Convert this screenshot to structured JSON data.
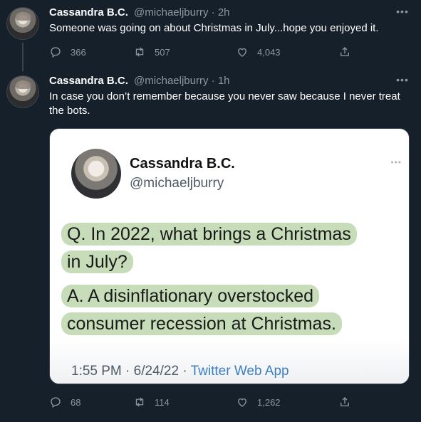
{
  "tweets": [
    {
      "name": "Cassandra B.C.",
      "handle": "@michaeljburry",
      "dot": "·",
      "time": "2h",
      "text": "Someone was going on about Christmas in July...hope you enjoyed it.",
      "counts": {
        "replies": "366",
        "retweets": "507",
        "likes": "4,043"
      }
    },
    {
      "name": "Cassandra B.C.",
      "handle": "@michaeljburry",
      "dot": "·",
      "time": "1h",
      "text": "In case you don’t remember because you never saw because I never treat the bots.",
      "counts": {
        "replies": "68",
        "retweets": "114",
        "likes": "1,262"
      },
      "media": {
        "name": "Cassandra B.C.",
        "handle": "@michaeljburry",
        "lines": [
          "Q. In 2022, what brings a Christmas",
          "in July?",
          "A. A disinflationary overstocked",
          "consumer recession at Christmas."
        ],
        "timestamp": "1:55 PM · 6/24/22 ·",
        "source": "Twitter Web App"
      }
    }
  ],
  "icons": {
    "more": "more-icon",
    "reply": "reply-icon",
    "retweet": "retweet-icon",
    "like": "like-icon",
    "share": "share-icon"
  },
  "colors": {
    "background": "#15202b",
    "muted": "#8b98a5",
    "highlight": "#c7dcb8",
    "link": "#3a7fc0"
  }
}
